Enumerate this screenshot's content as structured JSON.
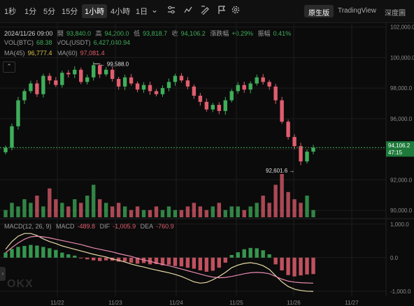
{
  "toolbar": {
    "timeframes": [
      "1秒",
      "1分",
      "5分",
      "15分",
      "1小時",
      "4小時",
      "1日"
    ],
    "active_timeframe": "1小時",
    "view_tabs": [
      "原生版",
      "TradingView",
      "深度圖"
    ],
    "active_view": "原生版"
  },
  "ohlc": {
    "date": "2024/11/26 09:00",
    "open_label": "開",
    "open": "93,840.0",
    "high_label": "高",
    "high": "94,200.0",
    "low_label": "低",
    "low": "93,818.7",
    "close_label": "收",
    "close": "94,106.2",
    "change_label": "漲跌幅",
    "change": "+0.29%",
    "amp_label": "振幅",
    "amp": "0.41%"
  },
  "volume_info": {
    "btc_label": "VOL(BTC)",
    "btc": "68.38",
    "usdt_label": "VOL(USDT)",
    "usdt": "6,427,040.94"
  },
  "ma_info": {
    "ma45_label": "MA(45)",
    "ma45": "96,777.4",
    "ma60_label": "MA(60)",
    "ma60": "97,081.4"
  },
  "macd_info": {
    "label": "MACD(12, 26, 9)",
    "macd_label": "MACD",
    "macd": "-489.8",
    "dif_label": "DIF",
    "dif": "-1,005.9",
    "dea_label": "DEA",
    "dea": "-760.9"
  },
  "watermark": "OKX",
  "colors": {
    "up": "#3fae5a",
    "down": "#e05e6e",
    "bg": "#0b0b0b",
    "grid": "#1c1c1c",
    "dif": "#e8d9a8",
    "dea": "#e88ab0",
    "current": "#1e7a3a"
  },
  "chart_data": {
    "type": "candlestick",
    "price_axis": {
      "ylim": [
        89500,
        102300
      ],
      "ticks": [
        90000,
        92000,
        94000,
        96000,
        98000,
        100000,
        102000
      ],
      "tick_labels": [
        "90,000.0",
        "92,000.0",
        "94,000.0",
        "96,000.0",
        "98,000.0",
        "100,000.0",
        "102,000.0"
      ]
    },
    "macd_axis": {
      "ylim": [
        -1150,
        1100
      ],
      "ticks": [
        1000,
        0,
        -1000
      ],
      "tick_labels": [
        "1,000.0",
        "0.0",
        "-1,000.0"
      ]
    },
    "x_axis": {
      "tick_labels": [
        "11/22",
        "11/23",
        "11/24",
        "11/25",
        "11/26",
        "11/27"
      ]
    },
    "current_price": "94,106.2",
    "countdown": "47:15",
    "annotations": {
      "high": "99,588.0",
      "high_price": 99588,
      "low": "92,601.6",
      "low_price": 92601.6
    },
    "close_path": [
      94100,
      95500,
      97200,
      97800,
      98300,
      97600,
      98800,
      98500,
      98200,
      99000,
      98900,
      99200,
      98400,
      98700,
      99500,
      98900,
      99200,
      98600,
      98100,
      98700,
      98300,
      97900,
      98200,
      97800,
      97600,
      98000,
      98400,
      98800,
      98500,
      98100,
      97500,
      97100,
      96600,
      96900,
      96500,
      97200,
      97800,
      98200,
      97900,
      98300,
      98700,
      98400,
      98100,
      97200,
      95800,
      94800,
      94200,
      93200,
      93840,
      94106
    ],
    "volumes": [
      2,
      4,
      3,
      5,
      4,
      6,
      3,
      8,
      5,
      4,
      3,
      5,
      4,
      6,
      9,
      5,
      4,
      3,
      4,
      3,
      2,
      3,
      2,
      2,
      3,
      2,
      3,
      2,
      2,
      3,
      4,
      3,
      2,
      3,
      4,
      2,
      3,
      3,
      2,
      3,
      4,
      6,
      4,
      9,
      12,
      7,
      5,
      4,
      6,
      2
    ],
    "macd_hist": [
      150,
      260,
      320,
      350,
      380,
      360,
      320,
      280,
      230,
      150,
      100,
      60,
      -20,
      -50,
      -80,
      -100,
      -80,
      -90,
      -120,
      -110,
      -150,
      -180,
      -160,
      -200,
      -190,
      -230,
      -210,
      -250,
      -260,
      -300,
      -330,
      -380,
      -420,
      -390,
      -300,
      -150,
      80,
      160,
      250,
      290,
      280,
      220,
      100,
      -200,
      -380,
      -520,
      -560,
      -530,
      -500,
      -489.8
    ],
    "dif_path": [
      250,
      480,
      640,
      720,
      720,
      660,
      560,
      480,
      420,
      350,
      300,
      250,
      200,
      150,
      100,
      60,
      20,
      -40,
      -80,
      -130,
      -190,
      -240,
      -280,
      -330,
      -370,
      -410,
      -450,
      -500,
      -560,
      -640,
      -720,
      -760,
      -740,
      -660,
      -560,
      -440,
      -300,
      -220,
      -170,
      -150,
      -180,
      -240,
      -350,
      -540,
      -720,
      -860,
      -940,
      -980,
      -1000,
      -1005.9
    ],
    "dea_path": [
      150,
      300,
      440,
      550,
      620,
      640,
      620,
      590,
      550,
      510,
      470,
      430,
      390,
      340,
      290,
      250,
      210,
      170,
      120,
      80,
      40,
      -20,
      -70,
      -110,
      -160,
      -200,
      -240,
      -290,
      -340,
      -390,
      -440,
      -490,
      -540,
      -580,
      -600,
      -590,
      -560,
      -520,
      -480,
      -450,
      -440,
      -450,
      -480,
      -560,
      -640,
      -700,
      -730,
      -745,
      -755,
      -760.9
    ]
  }
}
